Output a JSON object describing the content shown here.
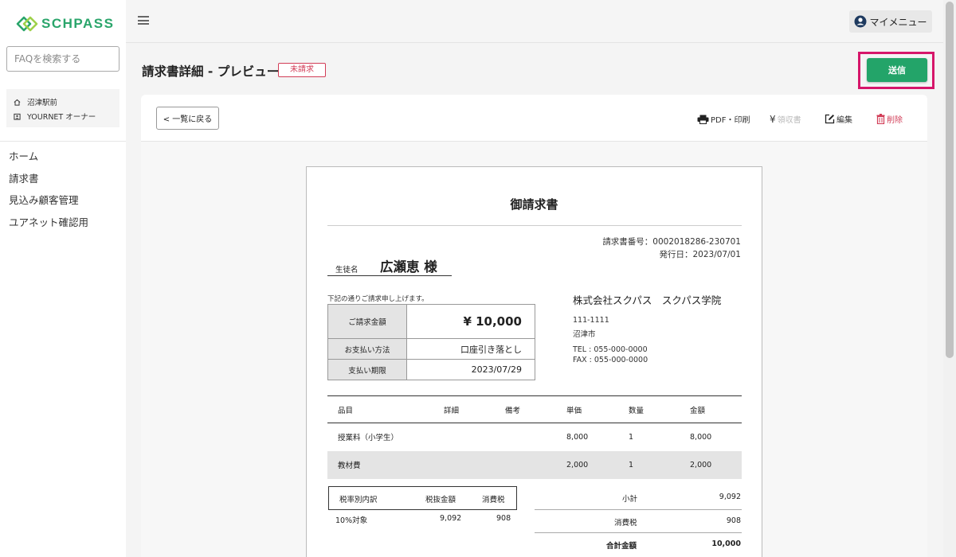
{
  "brand": {
    "name": "SCHPASS",
    "color": "#2aa56b"
  },
  "sidebar": {
    "faq_placeholder": "FAQを検索する",
    "school": {
      "place": "沼津駅前",
      "owner": "YOURNET オーナー"
    },
    "nav": [
      "ホーム",
      "請求書",
      "見込み顧客管理",
      "ユアネット確認用"
    ]
  },
  "header": {
    "mymenu_label": "マイメニュー"
  },
  "page": {
    "title": "請求書詳細 - プレビュー",
    "status_badge": "未請求",
    "send_label": "送信"
  },
  "toolbar": {
    "back_label": "< 一覧に戻る",
    "pdf_label": "PDF・印刷",
    "receipt_label": "領収書",
    "edit_label": "編集",
    "delete_label": "削除"
  },
  "invoice": {
    "title": "御請求書",
    "number_line": "請求書番号：0002018286-230701",
    "issue_line": "発行日：2023/07/01",
    "student_label": "生徒名",
    "student_name": "広瀬恵 様",
    "note": "下記の通りご請求申し上げます。",
    "summary": [
      {
        "label": "ご請求金額",
        "value": "¥ 10,000"
      },
      {
        "label": "お支払い方法",
        "value": "口座引き落とし"
      },
      {
        "label": "支払い期限",
        "value": "2023/07/29"
      }
    ],
    "company": "株式会社スクパス　スクパス学院",
    "postal": "111-1111",
    "city": "沼津市",
    "tel": "TEL : 055-000-0000",
    "fax": "FAX : 055-000-0000",
    "item_headers": [
      "品目",
      "詳細",
      "備考",
      "単価",
      "数量",
      "金額"
    ],
    "items": [
      {
        "name": "授業料（小学生）",
        "detail": "",
        "remark": "",
        "unit_price": "8,000",
        "qty": "1",
        "amount": "8,000"
      },
      {
        "name": "教材費",
        "detail": "",
        "remark": "",
        "unit_price": "2,000",
        "qty": "1",
        "amount": "2,000"
      }
    ],
    "tax_headers": [
      "税率別内訳",
      "税抜金額",
      "消費税"
    ],
    "tax_row": {
      "rate": "10%対象",
      "net": "9,092",
      "tax": "908"
    },
    "subtotal_label": "小計",
    "subtotal": "9,092",
    "consumption_label": "消費税",
    "consumption": "908",
    "total_label": "合計金額",
    "total": "10,000"
  },
  "colors": {
    "send": "#23a469",
    "highlight": "#d6166a",
    "badge": "#d23d57",
    "delete": "#d23d57"
  }
}
